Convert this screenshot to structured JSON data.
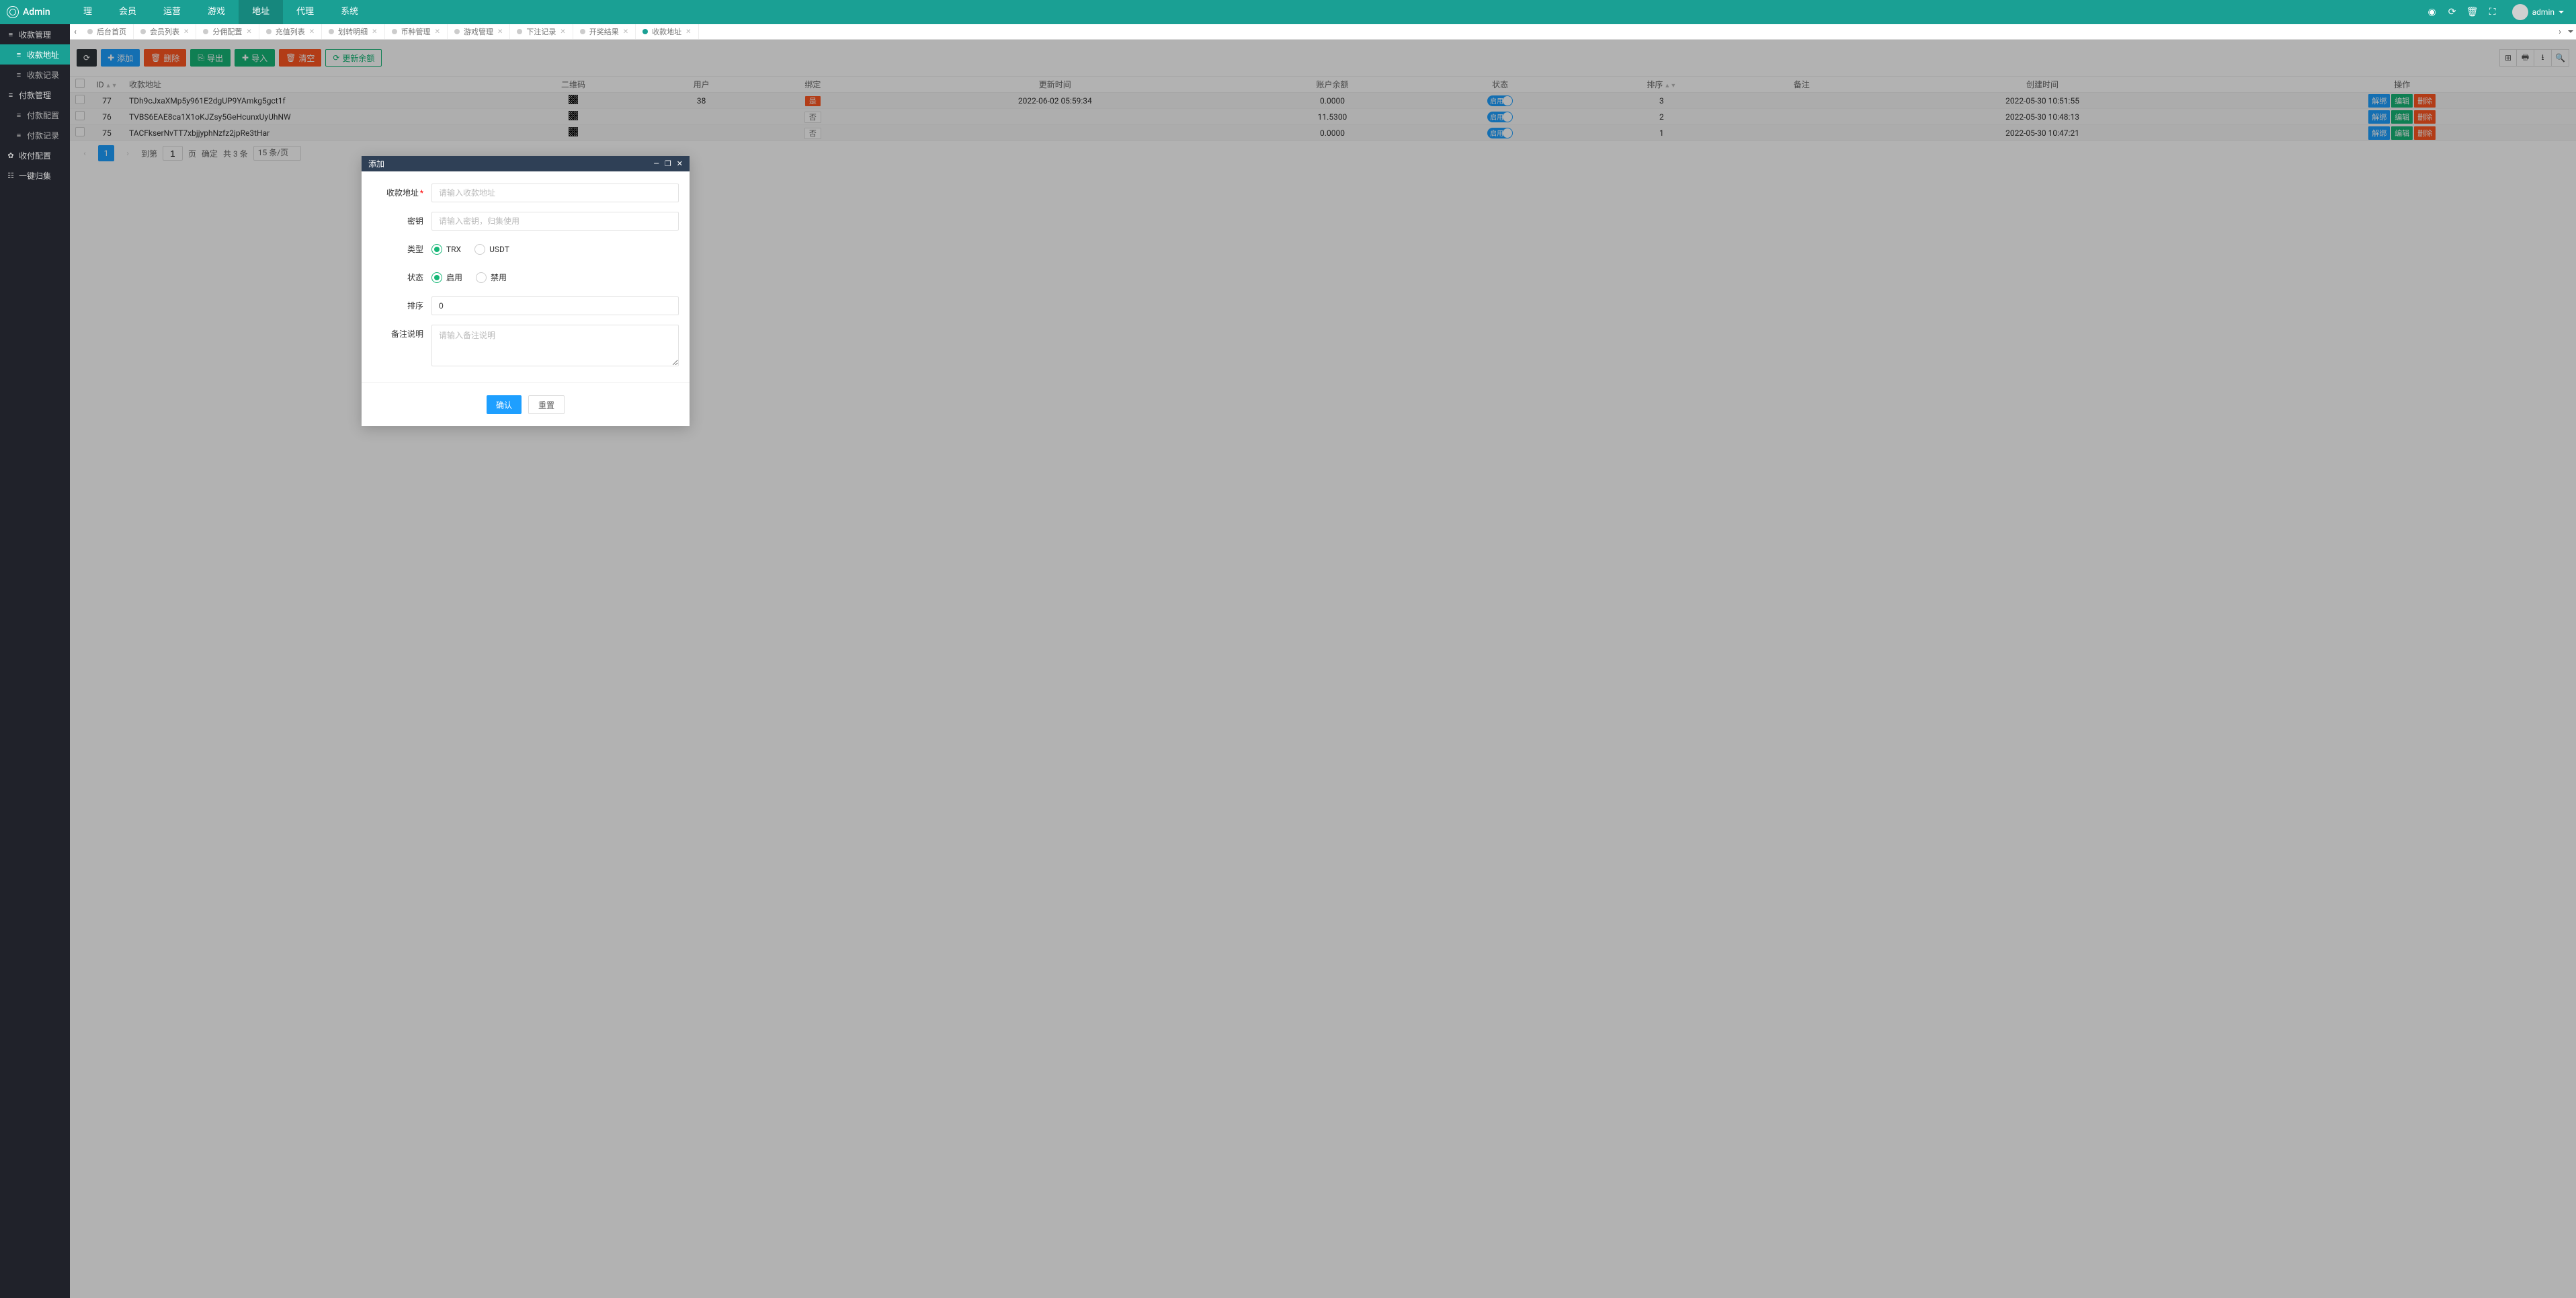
{
  "brand": "Admin",
  "topnav": [
    "理",
    "会员",
    "运营",
    "游戏",
    "地址",
    "代理",
    "系统"
  ],
  "topnav_active_index": 4,
  "user": {
    "name": "admin"
  },
  "sidebar": [
    {
      "label": "收款管理",
      "icon": "≡",
      "lvl": 1
    },
    {
      "label": "收款地址",
      "icon": "≡",
      "lvl": 2,
      "active": true
    },
    {
      "label": "收款记录",
      "icon": "≡",
      "lvl": 2
    },
    {
      "label": "付款管理",
      "icon": "≡",
      "lvl": 1
    },
    {
      "label": "付款配置",
      "icon": "≡",
      "lvl": 2
    },
    {
      "label": "付款记录",
      "icon": "≡",
      "lvl": 2
    },
    {
      "label": "收付配置",
      "icon": "✿",
      "lvl": 1
    },
    {
      "label": "一键归集",
      "icon": "☷",
      "lvl": 1
    }
  ],
  "tabs": [
    "后台首页",
    "会员列表",
    "分佣配置",
    "充值列表",
    "划转明细",
    "币种管理",
    "游戏管理",
    "下注记录",
    "开奖结果",
    "收款地址"
  ],
  "tabs_active_index": 9,
  "toolbar": {
    "refresh": "",
    "add": "添加",
    "delete": "删除",
    "export": "导出",
    "import": "导入",
    "clear": "清空",
    "refresh_balance": "更新余额"
  },
  "columns": [
    "",
    "ID",
    "收款地址",
    "二维码",
    "用户",
    "绑定",
    "更新时间",
    "账户余额",
    "状态",
    "排序",
    "备注",
    "创建时间",
    "操作"
  ],
  "rows": [
    {
      "id": "77",
      "addr": "TDh9cJxaXMp5y961E2dgUP9YAmkg5gct1f",
      "user": "38",
      "bound": true,
      "updated": "2022-06-02 05:59:34",
      "balance": "0.0000",
      "status": "启用",
      "sort": "3",
      "remark": "",
      "created": "2022-05-30 10:51:55"
    },
    {
      "id": "76",
      "addr": "TVBS6EAE8ca1X1oKJZsy5GeHcunxUyUhNW",
      "user": "",
      "bound": false,
      "updated": "",
      "balance": "11.5300",
      "status": "启用",
      "sort": "2",
      "remark": "",
      "created": "2022-05-30 10:48:13"
    },
    {
      "id": "75",
      "addr": "TACFkserNvTT7xbjjyphNzfz2jpRe3tHar",
      "user": "",
      "bound": false,
      "updated": "",
      "balance": "0.0000",
      "status": "启用",
      "sort": "1",
      "remark": "",
      "created": "2022-05-30 10:47:21"
    }
  ],
  "row_ops": {
    "unbind": "解绑",
    "edit": "编辑",
    "delete": "删除"
  },
  "bound_labels": {
    "yes": "是",
    "no": "否"
  },
  "pager": {
    "page": "1",
    "goto_label": "到第",
    "page_unit": "页",
    "confirm": "确定",
    "total": "共 3 条",
    "size": "15 条/页"
  },
  "modal": {
    "title": "添加",
    "fields": {
      "addr_label": "收款地址",
      "addr_placeholder": "请输入收款地址",
      "key_label": "密钥",
      "key_placeholder": "请输入密钥，归集使用",
      "type_label": "类型",
      "type_trx": "TRX",
      "type_usdt": "USDT",
      "status_label": "状态",
      "status_on": "启用",
      "status_off": "禁用",
      "sort_label": "排序",
      "sort_value": "0",
      "remark_label": "备注说明",
      "remark_placeholder": "请输入备注说明"
    },
    "confirm": "确认",
    "reset": "重置"
  }
}
